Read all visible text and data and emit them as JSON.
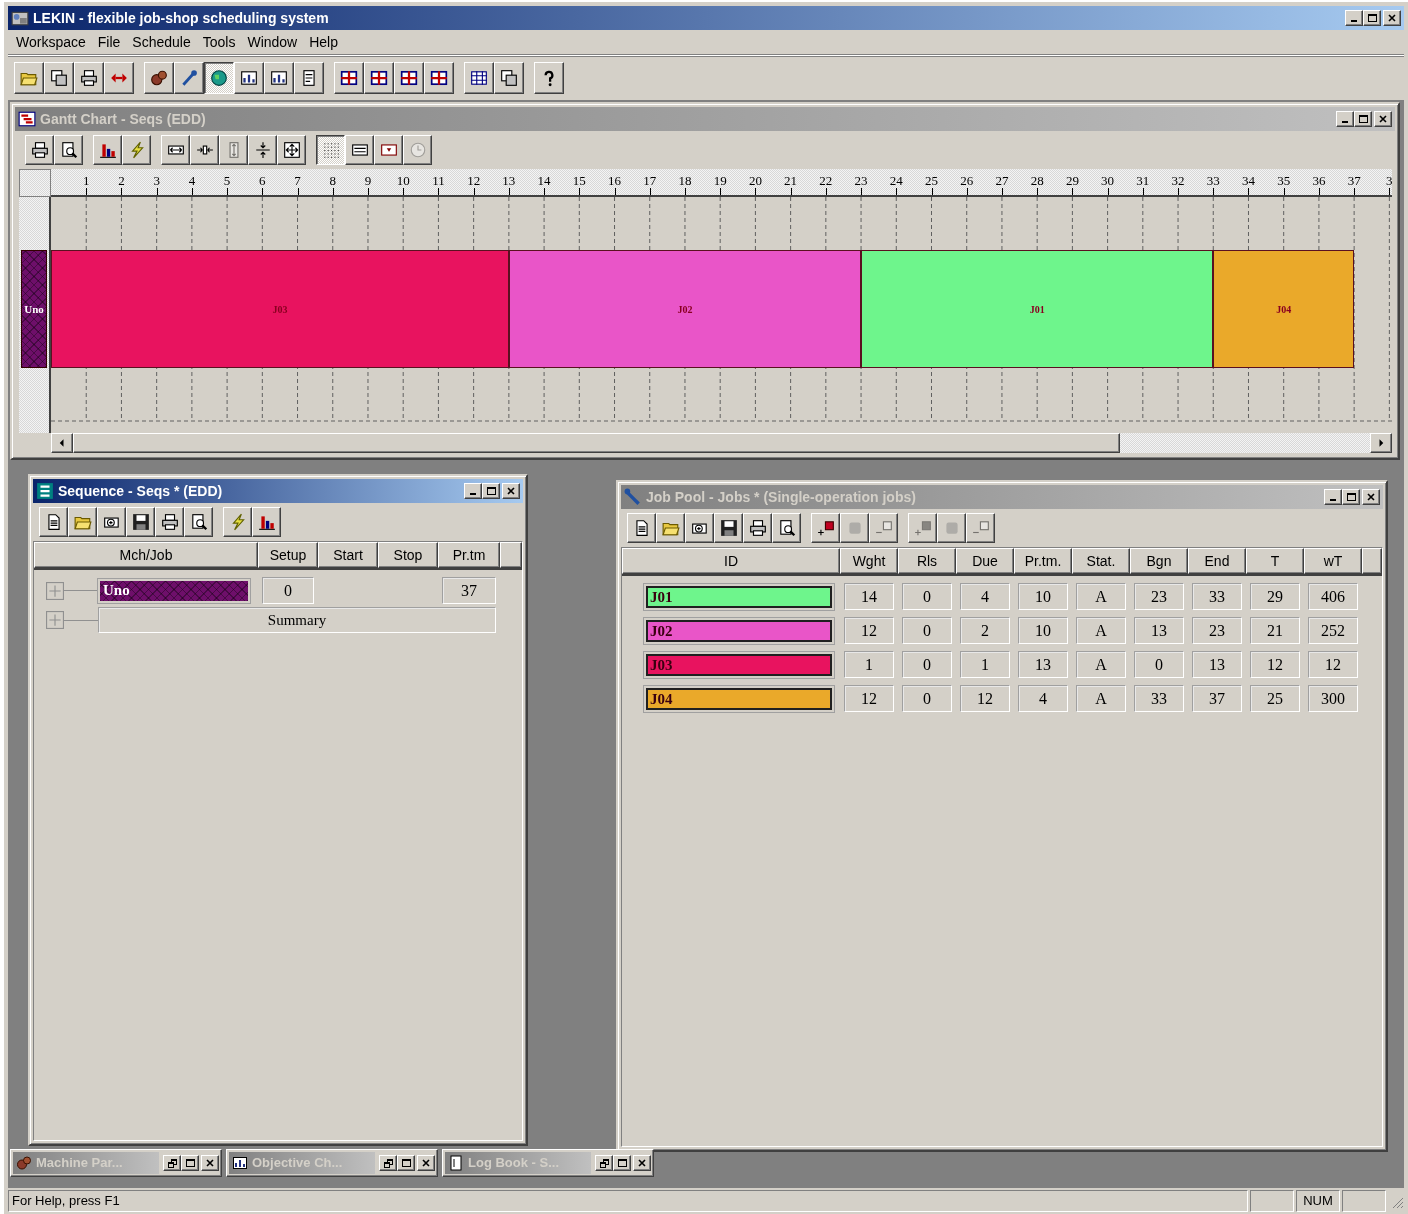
{
  "app": {
    "title": "LEKIN - flexible job-shop scheduling system"
  },
  "menu": [
    "Workspace",
    "File",
    "Schedule",
    "Tools",
    "Window",
    "Help"
  ],
  "toolbar": [
    [
      {
        "pressed": false
      },
      {
        "pressed": false
      },
      {
        "pressed": false
      },
      {
        "pressed": false
      }
    ],
    [
      {
        "pressed": false
      },
      {
        "pressed": false
      },
      {
        "pressed": true
      },
      {
        "pressed": false
      },
      {
        "pressed": false
      },
      {
        "pressed": false
      }
    ],
    [
      {
        "pressed": false
      },
      {
        "pressed": false
      },
      {
        "pressed": false
      },
      {
        "pressed": false
      }
    ],
    [
      {
        "pressed": false
      },
      {
        "pressed": false
      }
    ],
    [
      {
        "pressed": false
      }
    ]
  ],
  "gantt_window": {
    "title": "Gantt Chart - Seqs (EDD)",
    "active": false,
    "toolbar": [
      [
        {
          "pressed": false,
          "disabled": false
        },
        {
          "pressed": false,
          "disabled": false
        }
      ],
      [
        {
          "pressed": false,
          "disabled": false
        },
        {
          "pressed": false,
          "disabled": false
        }
      ],
      [
        {
          "pressed": false,
          "disabled": false
        },
        {
          "pressed": false,
          "disabled": false
        },
        {
          "pressed": false,
          "disabled": true
        },
        {
          "pressed": false,
          "disabled": false
        },
        {
          "pressed": false,
          "disabled": false
        }
      ],
      [
        {
          "pressed": true,
          "disabled": false
        },
        {
          "pressed": false,
          "disabled": false
        },
        {
          "pressed": false,
          "disabled": false
        },
        {
          "pressed": false,
          "disabled": true
        }
      ]
    ],
    "ruler_labels": [
      "1",
      "2",
      "3",
      "4",
      "5",
      "6",
      "7",
      "8",
      "9",
      "10",
      "11",
      "12",
      "13",
      "14",
      "15",
      "16",
      "17",
      "18",
      "19",
      "20",
      "21",
      "22",
      "23",
      "24",
      "25",
      "26",
      "27",
      "28",
      "29",
      "30",
      "31",
      "32",
      "33",
      "34",
      "35",
      "36",
      "37",
      "3"
    ],
    "machines": [
      {
        "label": "Uno",
        "color": "#6e0f6a"
      }
    ],
    "bars": [
      {
        "label": "J03",
        "color": "#e8135f"
      },
      {
        "label": "J02",
        "color": "#e955c8"
      },
      {
        "label": "J01",
        "color": "#6ef58c"
      },
      {
        "label": "J04",
        "color": "#eaa92a"
      }
    ]
  },
  "sequence_window": {
    "title": "Sequence - Seqs * (EDD)",
    "active": true,
    "toolbar": [
      [
        {
          "pressed": false
        },
        {
          "pressed": false
        },
        {
          "pressed": false
        },
        {
          "pressed": false
        },
        {
          "pressed": false
        },
        {
          "pressed": false
        }
      ],
      [
        {
          "pressed": false
        },
        {
          "pressed": false
        }
      ]
    ],
    "columns": [
      "Mch/Job",
      "Setup",
      "Start",
      "Stop",
      "Pr.tm"
    ],
    "rows": [
      {
        "kind": "machine",
        "expanded": false,
        "label": "Uno",
        "color": "#6e0f6a",
        "setup": "0",
        "prtm": "37"
      },
      {
        "kind": "summary",
        "expanded": false,
        "label": "Summary"
      }
    ]
  },
  "job_pool_window": {
    "title": "Job Pool - Jobs * (Single-operation jobs)",
    "active": false,
    "toolbar": [
      [
        {
          "disabled": false
        },
        {
          "disabled": false
        },
        {
          "disabled": false
        },
        {
          "disabled": false
        },
        {
          "disabled": false
        },
        {
          "disabled": false
        }
      ],
      [
        {
          "disabled": false
        },
        {
          "disabled": true
        },
        {
          "disabled": true
        }
      ],
      [
        {
          "disabled": true
        },
        {
          "disabled": true
        },
        {
          "disabled": true
        }
      ]
    ],
    "columns": [
      "ID",
      "Wght",
      "Rls",
      "Due",
      "Pr.tm.",
      "Stat.",
      "Bgn",
      "End",
      "T",
      "wT"
    ],
    "rows": [
      {
        "color": "#6ef58c",
        "cells": [
          "J01",
          "14",
          "0",
          "4",
          "10",
          "A",
          "23",
          "33",
          "29",
          "406"
        ]
      },
      {
        "color": "#e955c8",
        "cells": [
          "J02",
          "12",
          "0",
          "2",
          "10",
          "A",
          "13",
          "23",
          "21",
          "252"
        ]
      },
      {
        "color": "#e8135f",
        "cells": [
          "J03",
          "1",
          "0",
          "1",
          "13",
          "A",
          "0",
          "13",
          "12",
          "12"
        ]
      },
      {
        "color": "#eaa92a",
        "cells": [
          "J04",
          "12",
          "0",
          "12",
          "4",
          "A",
          "33",
          "37",
          "25",
          "300"
        ]
      }
    ]
  },
  "minimized_windows": [
    {
      "title": "Machine Par..."
    },
    {
      "title": "Objective Ch..."
    },
    {
      "title": "Log Book - S..."
    }
  ],
  "status_bar": {
    "text": "For Help, press F1",
    "indicators": [
      "NUM"
    ]
  }
}
